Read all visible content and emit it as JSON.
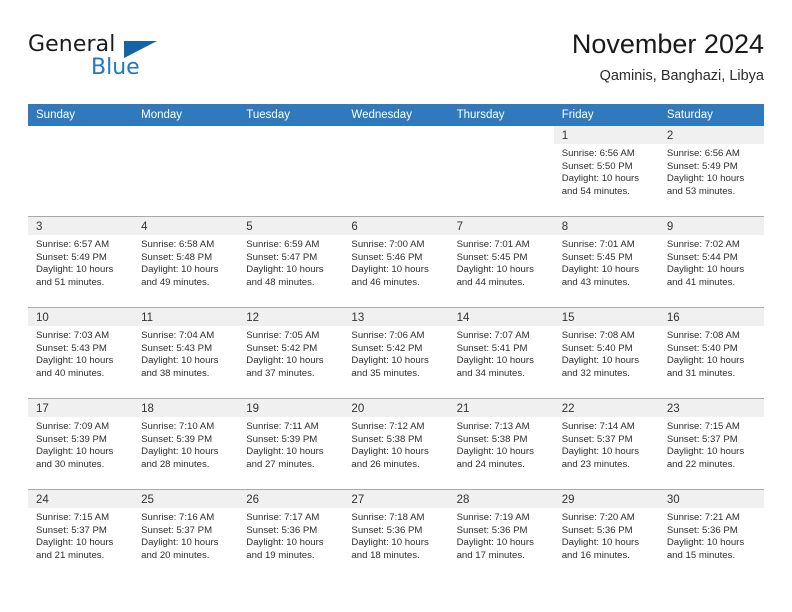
{
  "brand": {
    "word_one": "General",
    "word_two": "Blue",
    "flag_icon": "blue-triangle-flag-icon"
  },
  "header": {
    "title": "November 2024",
    "subtitle": "Qaminis, Banghazi, Libya"
  },
  "colors": {
    "header_blue": "#3079bd",
    "brand_blue": "#2577c2",
    "daynum_strip": "#f0f0f0",
    "grid_line": "#a9a9a9"
  },
  "weekdays": [
    "Sunday",
    "Monday",
    "Tuesday",
    "Wednesday",
    "Thursday",
    "Friday",
    "Saturday"
  ],
  "weeks": [
    [
      {
        "empty": true
      },
      {
        "empty": true
      },
      {
        "empty": true
      },
      {
        "empty": true
      },
      {
        "empty": true
      },
      {
        "day": "1",
        "sunrise": "Sunrise: 6:56 AM",
        "sunset": "Sunset: 5:50 PM",
        "daylight_1": "Daylight: 10 hours",
        "daylight_2": "and 54 minutes."
      },
      {
        "day": "2",
        "sunrise": "Sunrise: 6:56 AM",
        "sunset": "Sunset: 5:49 PM",
        "daylight_1": "Daylight: 10 hours",
        "daylight_2": "and 53 minutes."
      }
    ],
    [
      {
        "day": "3",
        "sunrise": "Sunrise: 6:57 AM",
        "sunset": "Sunset: 5:49 PM",
        "daylight_1": "Daylight: 10 hours",
        "daylight_2": "and 51 minutes."
      },
      {
        "day": "4",
        "sunrise": "Sunrise: 6:58 AM",
        "sunset": "Sunset: 5:48 PM",
        "daylight_1": "Daylight: 10 hours",
        "daylight_2": "and 49 minutes."
      },
      {
        "day": "5",
        "sunrise": "Sunrise: 6:59 AM",
        "sunset": "Sunset: 5:47 PM",
        "daylight_1": "Daylight: 10 hours",
        "daylight_2": "and 48 minutes."
      },
      {
        "day": "6",
        "sunrise": "Sunrise: 7:00 AM",
        "sunset": "Sunset: 5:46 PM",
        "daylight_1": "Daylight: 10 hours",
        "daylight_2": "and 46 minutes."
      },
      {
        "day": "7",
        "sunrise": "Sunrise: 7:01 AM",
        "sunset": "Sunset: 5:45 PM",
        "daylight_1": "Daylight: 10 hours",
        "daylight_2": "and 44 minutes."
      },
      {
        "day": "8",
        "sunrise": "Sunrise: 7:01 AM",
        "sunset": "Sunset: 5:45 PM",
        "daylight_1": "Daylight: 10 hours",
        "daylight_2": "and 43 minutes."
      },
      {
        "day": "9",
        "sunrise": "Sunrise: 7:02 AM",
        "sunset": "Sunset: 5:44 PM",
        "daylight_1": "Daylight: 10 hours",
        "daylight_2": "and 41 minutes."
      }
    ],
    [
      {
        "day": "10",
        "sunrise": "Sunrise: 7:03 AM",
        "sunset": "Sunset: 5:43 PM",
        "daylight_1": "Daylight: 10 hours",
        "daylight_2": "and 40 minutes."
      },
      {
        "day": "11",
        "sunrise": "Sunrise: 7:04 AM",
        "sunset": "Sunset: 5:43 PM",
        "daylight_1": "Daylight: 10 hours",
        "daylight_2": "and 38 minutes."
      },
      {
        "day": "12",
        "sunrise": "Sunrise: 7:05 AM",
        "sunset": "Sunset: 5:42 PM",
        "daylight_1": "Daylight: 10 hours",
        "daylight_2": "and 37 minutes."
      },
      {
        "day": "13",
        "sunrise": "Sunrise: 7:06 AM",
        "sunset": "Sunset: 5:42 PM",
        "daylight_1": "Daylight: 10 hours",
        "daylight_2": "and 35 minutes."
      },
      {
        "day": "14",
        "sunrise": "Sunrise: 7:07 AM",
        "sunset": "Sunset: 5:41 PM",
        "daylight_1": "Daylight: 10 hours",
        "daylight_2": "and 34 minutes."
      },
      {
        "day": "15",
        "sunrise": "Sunrise: 7:08 AM",
        "sunset": "Sunset: 5:40 PM",
        "daylight_1": "Daylight: 10 hours",
        "daylight_2": "and 32 minutes."
      },
      {
        "day": "16",
        "sunrise": "Sunrise: 7:08 AM",
        "sunset": "Sunset: 5:40 PM",
        "daylight_1": "Daylight: 10 hours",
        "daylight_2": "and 31 minutes."
      }
    ],
    [
      {
        "day": "17",
        "sunrise": "Sunrise: 7:09 AM",
        "sunset": "Sunset: 5:39 PM",
        "daylight_1": "Daylight: 10 hours",
        "daylight_2": "and 30 minutes."
      },
      {
        "day": "18",
        "sunrise": "Sunrise: 7:10 AM",
        "sunset": "Sunset: 5:39 PM",
        "daylight_1": "Daylight: 10 hours",
        "daylight_2": "and 28 minutes."
      },
      {
        "day": "19",
        "sunrise": "Sunrise: 7:11 AM",
        "sunset": "Sunset: 5:39 PM",
        "daylight_1": "Daylight: 10 hours",
        "daylight_2": "and 27 minutes."
      },
      {
        "day": "20",
        "sunrise": "Sunrise: 7:12 AM",
        "sunset": "Sunset: 5:38 PM",
        "daylight_1": "Daylight: 10 hours",
        "daylight_2": "and 26 minutes."
      },
      {
        "day": "21",
        "sunrise": "Sunrise: 7:13 AM",
        "sunset": "Sunset: 5:38 PM",
        "daylight_1": "Daylight: 10 hours",
        "daylight_2": "and 24 minutes."
      },
      {
        "day": "22",
        "sunrise": "Sunrise: 7:14 AM",
        "sunset": "Sunset: 5:37 PM",
        "daylight_1": "Daylight: 10 hours",
        "daylight_2": "and 23 minutes."
      },
      {
        "day": "23",
        "sunrise": "Sunrise: 7:15 AM",
        "sunset": "Sunset: 5:37 PM",
        "daylight_1": "Daylight: 10 hours",
        "daylight_2": "and 22 minutes."
      }
    ],
    [
      {
        "day": "24",
        "sunrise": "Sunrise: 7:15 AM",
        "sunset": "Sunset: 5:37 PM",
        "daylight_1": "Daylight: 10 hours",
        "daylight_2": "and 21 minutes."
      },
      {
        "day": "25",
        "sunrise": "Sunrise: 7:16 AM",
        "sunset": "Sunset: 5:37 PM",
        "daylight_1": "Daylight: 10 hours",
        "daylight_2": "and 20 minutes."
      },
      {
        "day": "26",
        "sunrise": "Sunrise: 7:17 AM",
        "sunset": "Sunset: 5:36 PM",
        "daylight_1": "Daylight: 10 hours",
        "daylight_2": "and 19 minutes."
      },
      {
        "day": "27",
        "sunrise": "Sunrise: 7:18 AM",
        "sunset": "Sunset: 5:36 PM",
        "daylight_1": "Daylight: 10 hours",
        "daylight_2": "and 18 minutes."
      },
      {
        "day": "28",
        "sunrise": "Sunrise: 7:19 AM",
        "sunset": "Sunset: 5:36 PM",
        "daylight_1": "Daylight: 10 hours",
        "daylight_2": "and 17 minutes."
      },
      {
        "day": "29",
        "sunrise": "Sunrise: 7:20 AM",
        "sunset": "Sunset: 5:36 PM",
        "daylight_1": "Daylight: 10 hours",
        "daylight_2": "and 16 minutes."
      },
      {
        "day": "30",
        "sunrise": "Sunrise: 7:21 AM",
        "sunset": "Sunset: 5:36 PM",
        "daylight_1": "Daylight: 10 hours",
        "daylight_2": "and 15 minutes."
      }
    ]
  ]
}
